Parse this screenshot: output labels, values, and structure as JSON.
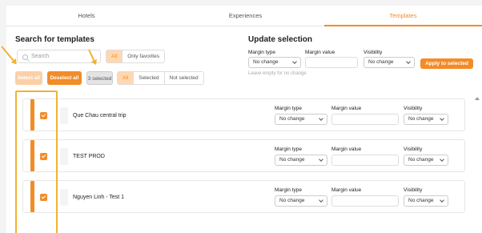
{
  "tabs": [
    {
      "label": "Hotels",
      "active": false
    },
    {
      "label": "Experiences",
      "active": false
    },
    {
      "label": "Templates",
      "active": true
    }
  ],
  "search_section": {
    "title": "Search for templates",
    "search_placeholder": "Search",
    "favorites_filter": [
      "All",
      "Only favorites"
    ],
    "favorites_selected": "All",
    "select_all_label": "Select all",
    "deselect_all_label": "Deselect all",
    "selected_count_label": "3 selected",
    "selection_filter": [
      "All",
      "Selected",
      "Not selected"
    ],
    "selection_filter_selected": "All"
  },
  "update_section": {
    "title": "Update selection",
    "margin_type_label": "Margin type",
    "margin_type_value": "No change",
    "margin_value_label": "Margin value",
    "margin_value_value": "",
    "margin_value_hint": "Leave empty for no change",
    "visibility_label": "Visibility",
    "visibility_value": "No change",
    "apply_label": "Apply to selected"
  },
  "templates": [
    {
      "name": "Que Chau central trip",
      "checked": true,
      "margin_type_label": "Margin type",
      "margin_type": "No change",
      "margin_value_label": "Margin value",
      "margin_value": "",
      "visibility_label": "Visibility",
      "visibility": "No change"
    },
    {
      "name": "TEST PROD",
      "checked": true,
      "margin_type_label": "Margin type",
      "margin_type": "No change",
      "margin_value_label": "Margin value",
      "margin_value": "",
      "visibility_label": "Visibility",
      "visibility": "No change"
    },
    {
      "name": "Nguyen Linh - Test 1",
      "checked": true,
      "margin_type_label": "Margin type",
      "margin_type": "No change",
      "margin_value_label": "Margin value",
      "margin_value": "",
      "visibility_label": "Visibility",
      "visibility": "No change"
    }
  ],
  "colors": {
    "accent": "#f28c28",
    "annotation": "#f2b233"
  },
  "icons": [
    "search-icon",
    "chevron-down-icon",
    "check-icon",
    "scroll-up-icon"
  ]
}
